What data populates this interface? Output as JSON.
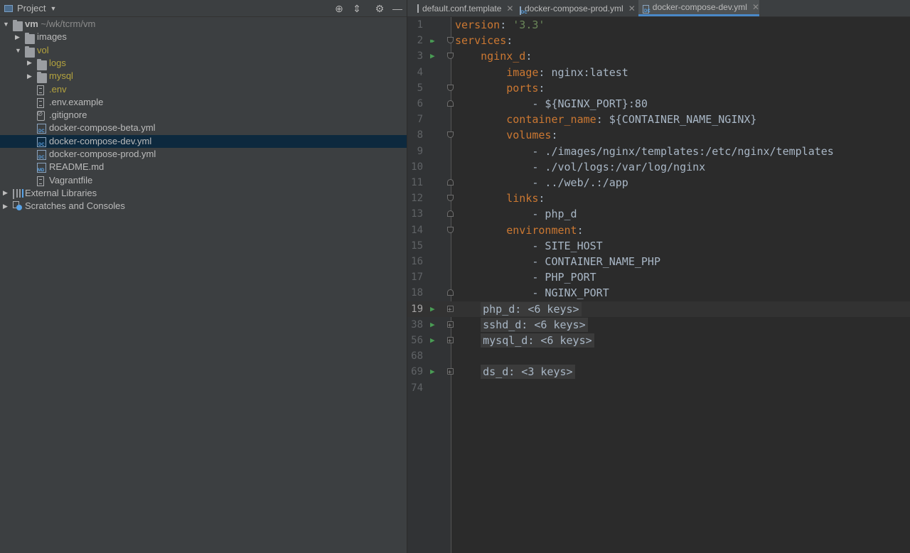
{
  "project_panel": {
    "title": "Project",
    "toolbar_icons": [
      "locate-icon",
      "collapse-all-icon",
      "gear-icon",
      "hide-icon"
    ],
    "tree": [
      {
        "name": "vm",
        "path": "~/wk/tcrm/vm",
        "type": "folder",
        "indent": 0,
        "expanded": true
      },
      {
        "name": "images",
        "type": "folder",
        "indent": 1,
        "expanded": false
      },
      {
        "name": "vol",
        "type": "folder",
        "indent": 1,
        "expanded": true,
        "highlight": true
      },
      {
        "name": "logs",
        "type": "folder",
        "indent": 2,
        "expanded": false,
        "highlight": true
      },
      {
        "name": "mysql",
        "type": "folder",
        "indent": 2,
        "expanded": false,
        "highlight": true
      },
      {
        "name": ".env",
        "type": "file",
        "indent": 2,
        "highlight": true
      },
      {
        "name": ".env.example",
        "type": "file",
        "indent": 2
      },
      {
        "name": ".gitignore",
        "type": "git",
        "indent": 2
      },
      {
        "name": "docker-compose-beta.yml",
        "type": "yml",
        "indent": 2
      },
      {
        "name": "docker-compose-dev.yml",
        "type": "yml",
        "indent": 2,
        "selected": true
      },
      {
        "name": "docker-compose-prod.yml",
        "type": "yml",
        "indent": 2
      },
      {
        "name": "README.md",
        "type": "md",
        "indent": 2
      },
      {
        "name": "Vagrantfile",
        "type": "file",
        "indent": 2
      },
      {
        "name": "External Libraries",
        "type": "libs",
        "indent": 0,
        "expanded": false
      },
      {
        "name": "Scratches and Consoles",
        "type": "scratch",
        "indent": 0,
        "expanded": false
      }
    ]
  },
  "tabs": [
    {
      "label": "default.conf.template",
      "icon": "file-icon",
      "active": false
    },
    {
      "label": "docker-compose-prod.yml",
      "icon": "yaml-file-icon",
      "active": false
    },
    {
      "label": "docker-compose-dev.yml",
      "icon": "yaml-file-icon",
      "active": true
    }
  ],
  "editor": {
    "current_line": "19",
    "lines": [
      {
        "n": "1",
        "parts": [
          [
            "k",
            "version"
          ],
          [
            "v",
            ": "
          ],
          [
            "s",
            "'3.3'"
          ]
        ]
      },
      {
        "n": "2",
        "parts": [
          [
            "k",
            "services"
          ],
          [
            "v",
            ":"
          ]
        ],
        "run": "double",
        "fold": "open"
      },
      {
        "n": "3",
        "parts": [
          [
            "v",
            "    "
          ],
          [
            "k",
            "nginx_d"
          ],
          [
            "v",
            ":"
          ]
        ],
        "run": "single",
        "fold": "open"
      },
      {
        "n": "4",
        "parts": [
          [
            "v",
            "        "
          ],
          [
            "k",
            "image"
          ],
          [
            "v",
            ": nginx:latest"
          ]
        ]
      },
      {
        "n": "5",
        "parts": [
          [
            "v",
            "        "
          ],
          [
            "k",
            "ports"
          ],
          [
            "v",
            ":"
          ]
        ],
        "fold": "open"
      },
      {
        "n": "6",
        "parts": [
          [
            "v",
            "            - ${NGINX_PORT}:80"
          ]
        ],
        "fold": "close"
      },
      {
        "n": "7",
        "parts": [
          [
            "v",
            "        "
          ],
          [
            "k",
            "container_name"
          ],
          [
            "v",
            ": ${CONTAINER_NAME_NGINX}"
          ]
        ]
      },
      {
        "n": "8",
        "parts": [
          [
            "v",
            "        "
          ],
          [
            "k",
            "volumes"
          ],
          [
            "v",
            ":"
          ]
        ],
        "fold": "open"
      },
      {
        "n": "9",
        "parts": [
          [
            "v",
            "            - ./images/nginx/templates:/etc/nginx/templates"
          ]
        ]
      },
      {
        "n": "10",
        "parts": [
          [
            "v",
            "            - ./vol/logs:/var/log/nginx"
          ]
        ]
      },
      {
        "n": "11",
        "parts": [
          [
            "v",
            "            - ../web/.:/app"
          ]
        ],
        "fold": "close"
      },
      {
        "n": "12",
        "parts": [
          [
            "v",
            "        "
          ],
          [
            "k",
            "links"
          ],
          [
            "v",
            ":"
          ]
        ],
        "fold": "open"
      },
      {
        "n": "13",
        "parts": [
          [
            "v",
            "            - php_d"
          ]
        ],
        "fold": "close"
      },
      {
        "n": "14",
        "parts": [
          [
            "v",
            "        "
          ],
          [
            "k",
            "environment"
          ],
          [
            "v",
            ":"
          ]
        ],
        "fold": "open"
      },
      {
        "n": "15",
        "parts": [
          [
            "v",
            "            - SITE_HOST"
          ]
        ]
      },
      {
        "n": "16",
        "parts": [
          [
            "v",
            "            - CONTAINER_NAME_PHP"
          ]
        ]
      },
      {
        "n": "17",
        "parts": [
          [
            "v",
            "            - PHP_PORT"
          ]
        ]
      },
      {
        "n": "18",
        "parts": [
          [
            "v",
            "            - NGINX_PORT"
          ]
        ],
        "fold": "close"
      },
      {
        "n": "19",
        "parts": [
          [
            "v",
            "    "
          ],
          [
            "c",
            "php_d: <6 keys>"
          ]
        ],
        "run": "single",
        "fold": "plus"
      },
      {
        "n": "38",
        "parts": [
          [
            "v",
            "    "
          ],
          [
            "c",
            "sshd_d: <6 keys>"
          ]
        ],
        "run": "single",
        "fold": "plus"
      },
      {
        "n": "56",
        "parts": [
          [
            "v",
            "    "
          ],
          [
            "c",
            "mysql_d: <6 keys>"
          ]
        ],
        "run": "single",
        "fold": "plus"
      },
      {
        "n": "68",
        "parts": []
      },
      {
        "n": "69",
        "parts": [
          [
            "v",
            "    "
          ],
          [
            "c",
            "ds_d: <3 keys>"
          ]
        ],
        "run": "single",
        "fold": "plus"
      },
      {
        "n": "74",
        "parts": []
      }
    ]
  }
}
